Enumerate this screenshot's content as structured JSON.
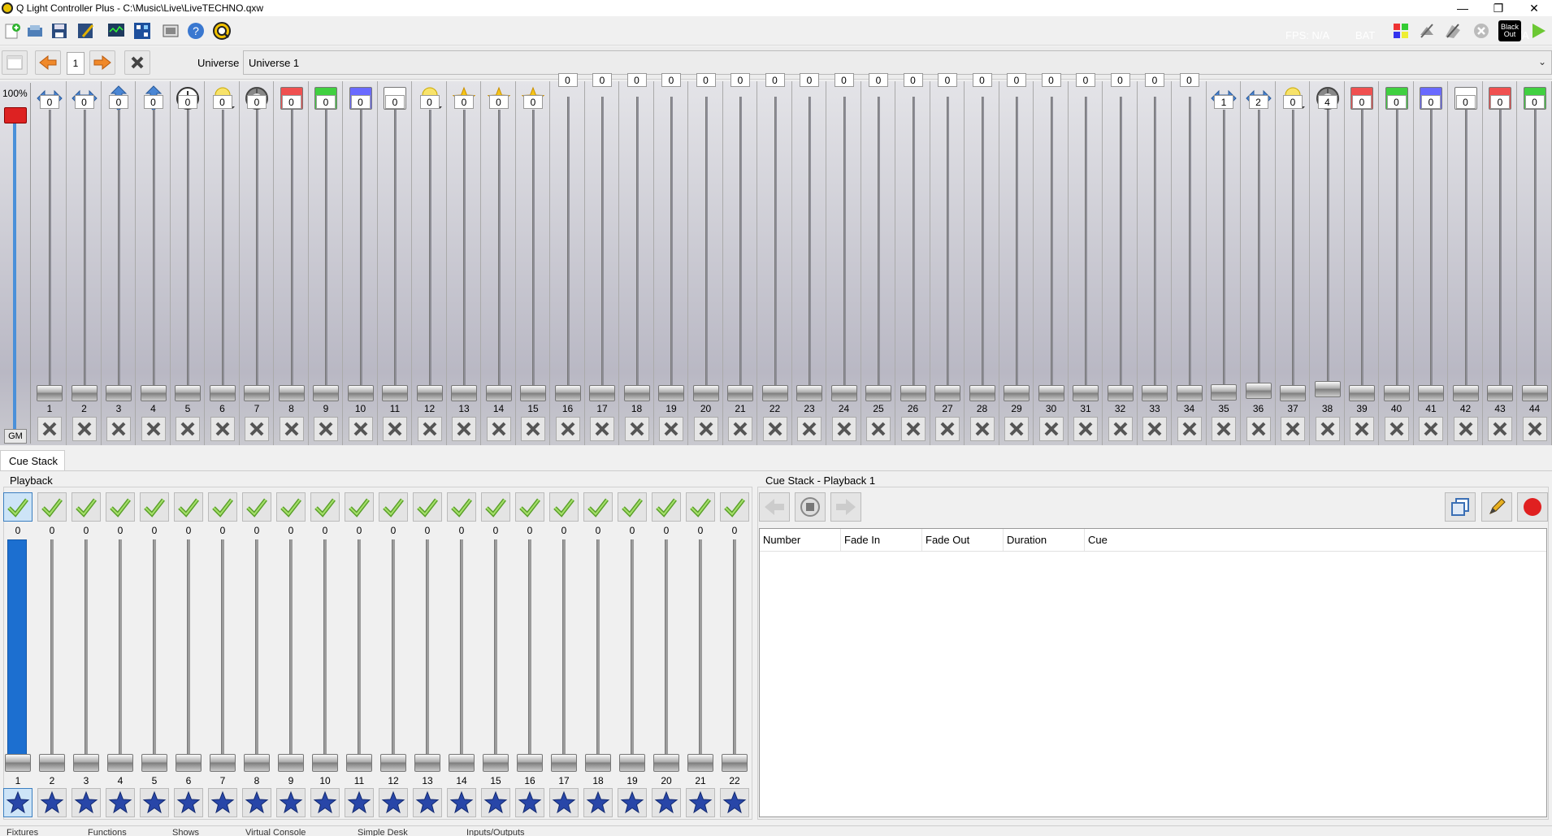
{
  "window": {
    "title": "Q Light Controller Plus - C:\\Music\\Live\\LiveTECHNO.qxw",
    "controls": [
      "minimize",
      "restore",
      "close"
    ],
    "ghost_text": [
      "FPS: N/A",
      "BAT",
      "N/A"
    ]
  },
  "toolbar": {
    "left_icons": [
      "new-workspace-icon",
      "open-icon",
      "save-icon",
      "save-as-icon",
      "monitor-icon",
      "address-tool-icon",
      "fullscreen-icon",
      "help-icon",
      "qlc-logo-icon"
    ],
    "right_icons": [
      "dmx-dump-icon",
      "disable-io-icon",
      "blackout-lock-icon",
      "stop-all-icon",
      "blackout-icon",
      "mode-play-icon"
    ],
    "blackout_label": "Black Out"
  },
  "simpledesk": {
    "page_value": "1",
    "universe_label": "Universe",
    "universe_value": "Universe 1",
    "grand_master": {
      "percent": "100%",
      "button": "GM",
      "level": 1.0
    },
    "channels": [
      {
        "num": "1",
        "val": "0",
        "icon": "pan-arrow-icon"
      },
      {
        "num": "2",
        "val": "0",
        "icon": "pan-arrow-icon"
      },
      {
        "num": "3",
        "val": "0",
        "icon": "tilt-arrow-icon"
      },
      {
        "num": "4",
        "val": "0",
        "icon": "tilt-arrow-icon"
      },
      {
        "num": "5",
        "val": "0",
        "icon": "speed-clock-icon"
      },
      {
        "num": "6",
        "val": "0",
        "icon": "intensity-bulb-icon"
      },
      {
        "num": "7",
        "val": "0",
        "icon": "shutter-icon"
      },
      {
        "num": "8",
        "val": "0",
        "icon": "red-color-icon",
        "letter": "R",
        "color": "#f05050"
      },
      {
        "num": "9",
        "val": "0",
        "icon": "green-color-icon",
        "letter": "G",
        "color": "#40d040"
      },
      {
        "num": "10",
        "val": "0",
        "icon": "blue-color-icon",
        "letter": "B",
        "color": "#6a6aff"
      },
      {
        "num": "11",
        "val": "0",
        "icon": "white-color-icon",
        "letter": "W",
        "color": "#ffffff"
      },
      {
        "num": "12",
        "val": "0",
        "icon": "intensity-bulb-icon"
      },
      {
        "num": "13",
        "val": "0",
        "icon": "star-icon"
      },
      {
        "num": "14",
        "val": "0",
        "icon": "star-icon"
      },
      {
        "num": "15",
        "val": "0",
        "icon": "star-icon"
      },
      {
        "num": "16",
        "val": "0",
        "icon": ""
      },
      {
        "num": "17",
        "val": "0",
        "icon": ""
      },
      {
        "num": "18",
        "val": "0",
        "icon": ""
      },
      {
        "num": "19",
        "val": "0",
        "icon": ""
      },
      {
        "num": "20",
        "val": "0",
        "icon": ""
      },
      {
        "num": "21",
        "val": "0",
        "icon": ""
      },
      {
        "num": "22",
        "val": "0",
        "icon": ""
      },
      {
        "num": "23",
        "val": "0",
        "icon": ""
      },
      {
        "num": "24",
        "val": "0",
        "icon": ""
      },
      {
        "num": "25",
        "val": "0",
        "icon": ""
      },
      {
        "num": "26",
        "val": "0",
        "icon": ""
      },
      {
        "num": "27",
        "val": "0",
        "icon": ""
      },
      {
        "num": "28",
        "val": "0",
        "icon": ""
      },
      {
        "num": "29",
        "val": "0",
        "icon": ""
      },
      {
        "num": "30",
        "val": "0",
        "icon": ""
      },
      {
        "num": "31",
        "val": "0",
        "icon": ""
      },
      {
        "num": "32",
        "val": "0",
        "icon": ""
      },
      {
        "num": "33",
        "val": "0",
        "icon": ""
      },
      {
        "num": "34",
        "val": "0",
        "icon": ""
      },
      {
        "num": "35",
        "val": "1",
        "icon": "pan-arrow-icon"
      },
      {
        "num": "36",
        "val": "2",
        "icon": "pan-arrow-icon"
      },
      {
        "num": "37",
        "val": "0",
        "icon": "intensity-bulb-icon"
      },
      {
        "num": "38",
        "val": "4",
        "icon": "shutter-icon"
      },
      {
        "num": "39",
        "val": "0",
        "icon": "red-color-icon",
        "letter": "R",
        "color": "#f05050"
      },
      {
        "num": "40",
        "val": "0",
        "icon": "green-color-icon",
        "letter": "G",
        "color": "#40d040"
      },
      {
        "num": "41",
        "val": "0",
        "icon": "blue-color-icon",
        "letter": "B",
        "color": "#6a6aff"
      },
      {
        "num": "42",
        "val": "0",
        "icon": "white-color-icon",
        "letter": "W",
        "color": "#ffffff"
      },
      {
        "num": "43",
        "val": "0",
        "icon": "red-color-icon",
        "letter": "R",
        "color": "#f05050"
      },
      {
        "num": "44",
        "val": "0",
        "icon": "green-color-icon",
        "letter": "G",
        "color": "#40d040"
      }
    ]
  },
  "cue_stack": {
    "tab_label": "Cue Stack",
    "playback_group_label": "Playback",
    "selected_playback": "1",
    "playbacks": [
      {
        "label": "1",
        "value": "0"
      },
      {
        "label": "2",
        "value": "0"
      },
      {
        "label": "3",
        "value": "0"
      },
      {
        "label": "4",
        "value": "0"
      },
      {
        "label": "5",
        "value": "0"
      },
      {
        "label": "6",
        "value": "0"
      },
      {
        "label": "7",
        "value": "0"
      },
      {
        "label": "8",
        "value": "0"
      },
      {
        "label": "9",
        "value": "0"
      },
      {
        "label": "10",
        "value": "0"
      },
      {
        "label": "11",
        "value": "0"
      },
      {
        "label": "12",
        "value": "0"
      },
      {
        "label": "13",
        "value": "0"
      },
      {
        "label": "14",
        "value": "0"
      },
      {
        "label": "15",
        "value": "0"
      },
      {
        "label": "16",
        "value": "0"
      },
      {
        "label": "17",
        "value": "0"
      },
      {
        "label": "18",
        "value": "0"
      },
      {
        "label": "19",
        "value": "0"
      },
      {
        "label": "20",
        "value": "0"
      },
      {
        "label": "21",
        "value": "0"
      },
      {
        "label": "22",
        "value": "0"
      }
    ],
    "editor_label": "Cue Stack - Playback 1",
    "columns": [
      "Number",
      "Fade In",
      "Fade Out",
      "Duration",
      "Cue"
    ]
  },
  "bottom_tabs": [
    "Fixtures",
    "Functions",
    "Shows",
    "Virtual Console",
    "Simple Desk",
    "Inputs/Outputs"
  ]
}
